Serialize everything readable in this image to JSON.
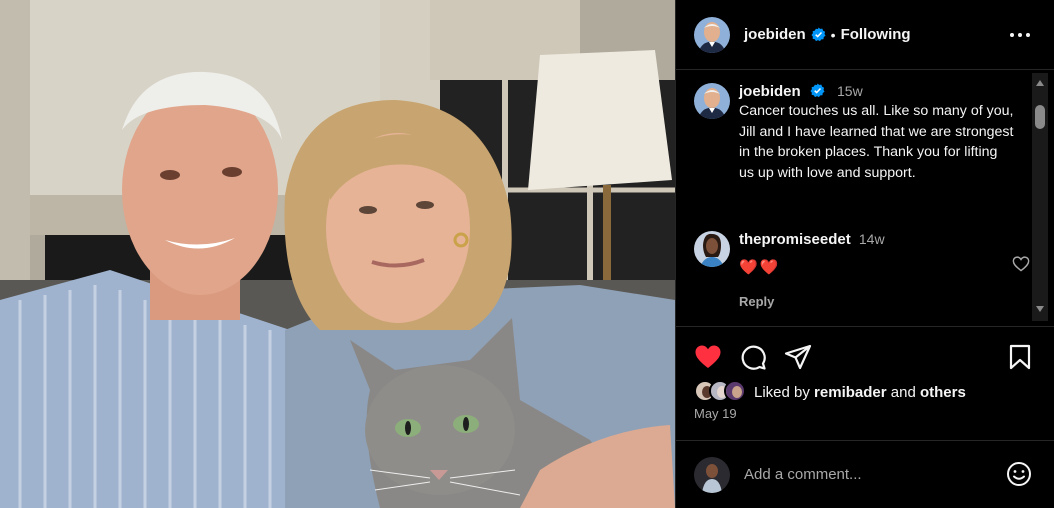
{
  "post": {
    "author": "joebiden",
    "follow_state": "Following",
    "separator": "•",
    "verified": true
  },
  "caption": {
    "username": "joebiden",
    "time": "15w",
    "text": "Cancer touches us all. Like so many of you, Jill and I have learned that we are strongest in the broken places. Thank you for lifting us up with love and support."
  },
  "comment": {
    "username": "thepromiseedet",
    "time": "14w",
    "text": "❤️❤️",
    "reply_label": "Reply"
  },
  "likes": {
    "prefix": "Liked by",
    "user": "remibader",
    "conjunction": "and",
    "others": "others"
  },
  "date": "May 19",
  "composer": {
    "placeholder": "Add a comment..."
  },
  "colors": {
    "like_red": "#ff3040",
    "verified_blue": "#0095f6",
    "secondary_text": "#a8a8a8"
  },
  "icons": {
    "more": "more-options-icon",
    "like": "heart-filled-icon",
    "comment": "comment-icon",
    "share": "share-icon",
    "save": "bookmark-icon",
    "emoji": "emoji-icon"
  }
}
